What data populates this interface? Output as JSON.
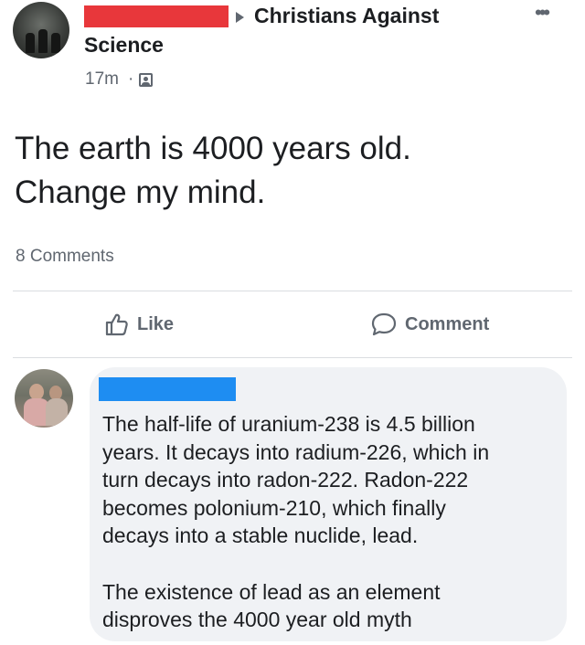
{
  "post": {
    "group_name_line1": "Christians Against",
    "group_name_line2": "Science",
    "timestamp": "17m",
    "separator": "·",
    "audience_icon": "group-audience-icon",
    "body_lines": [
      "The earth is 4000 years old.",
      "Change my mind."
    ],
    "comments_count": "8 Comments"
  },
  "actions": {
    "like_label": "Like",
    "comment_label": "Comment"
  },
  "comment": {
    "paragraph1_lines": [
      "The half-life of uranium-238 is 4.5 billion",
      "years. It decays into radium-226, which in",
      "turn decays into radon-222. Radon-222",
      "becomes polonium-210, which finally",
      "decays into a stable nuclide, lead."
    ],
    "paragraph2_lines": [
      "The existence of lead as an element",
      "disproves the 4000 year old myth"
    ]
  },
  "colors": {
    "redaction_red": "#e8373b",
    "redaction_blue": "#1e8df2",
    "comment_bubble": "#f0f2f5",
    "secondary_text": "#606770"
  }
}
